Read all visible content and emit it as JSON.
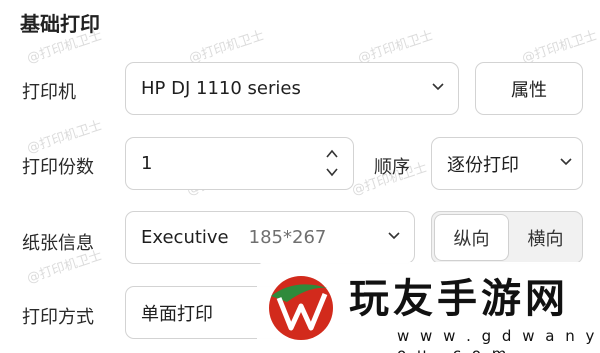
{
  "section_title": "基础打印",
  "watermark": "@打印机卫士",
  "printer": {
    "label": "打印机",
    "value": "HP DJ 1110 series",
    "properties_button": "属性"
  },
  "copies": {
    "label": "打印份数",
    "value": "1",
    "order_label": "顺序",
    "order_value": "逐份打印"
  },
  "paper": {
    "label": "纸张信息",
    "size_name": "Executive",
    "size_dims": "185*267",
    "orientation": {
      "portrait": "纵向",
      "landscape": "横向",
      "selected": "portrait"
    }
  },
  "print_mode": {
    "label": "打印方式",
    "value": "单面打印"
  },
  "logo": {
    "name": "玩友手游网",
    "url": "w w w . g d w a n y o u . c o m",
    "accent_red": "#d22a1c",
    "accent_green": "#2f8a3b"
  }
}
